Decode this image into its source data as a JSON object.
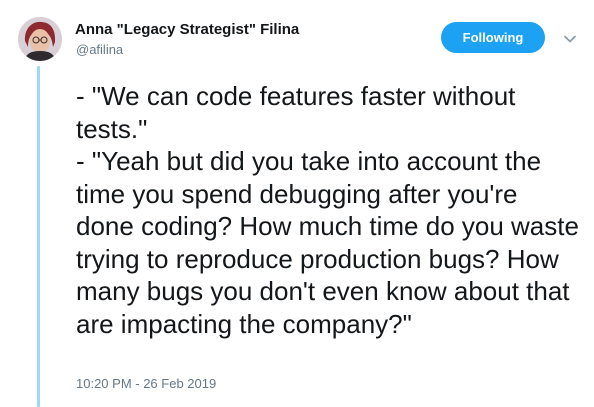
{
  "author": {
    "display_name": "Anna \"Legacy Strategist\" Filina",
    "handle": "@afilina"
  },
  "follow_button": {
    "label": "Following"
  },
  "icons": {
    "menu": "chevron-down-icon",
    "avatar": "profile-photo"
  },
  "tweet": {
    "text": "- \"We can code features faster without tests.\"\n- \"Yeah but did you take into account the time you spend debugging after you're done coding? How much time do you waste trying to reproduce production bugs? How many bugs you don't even know about that are impacting the company?\"",
    "timestamp": "10:20 PM - 26 Feb 2019"
  },
  "colors": {
    "accent": "#1da1f2",
    "thread_line": "#9fd7f7",
    "text": "#14171a",
    "secondary_text": "#657786"
  }
}
